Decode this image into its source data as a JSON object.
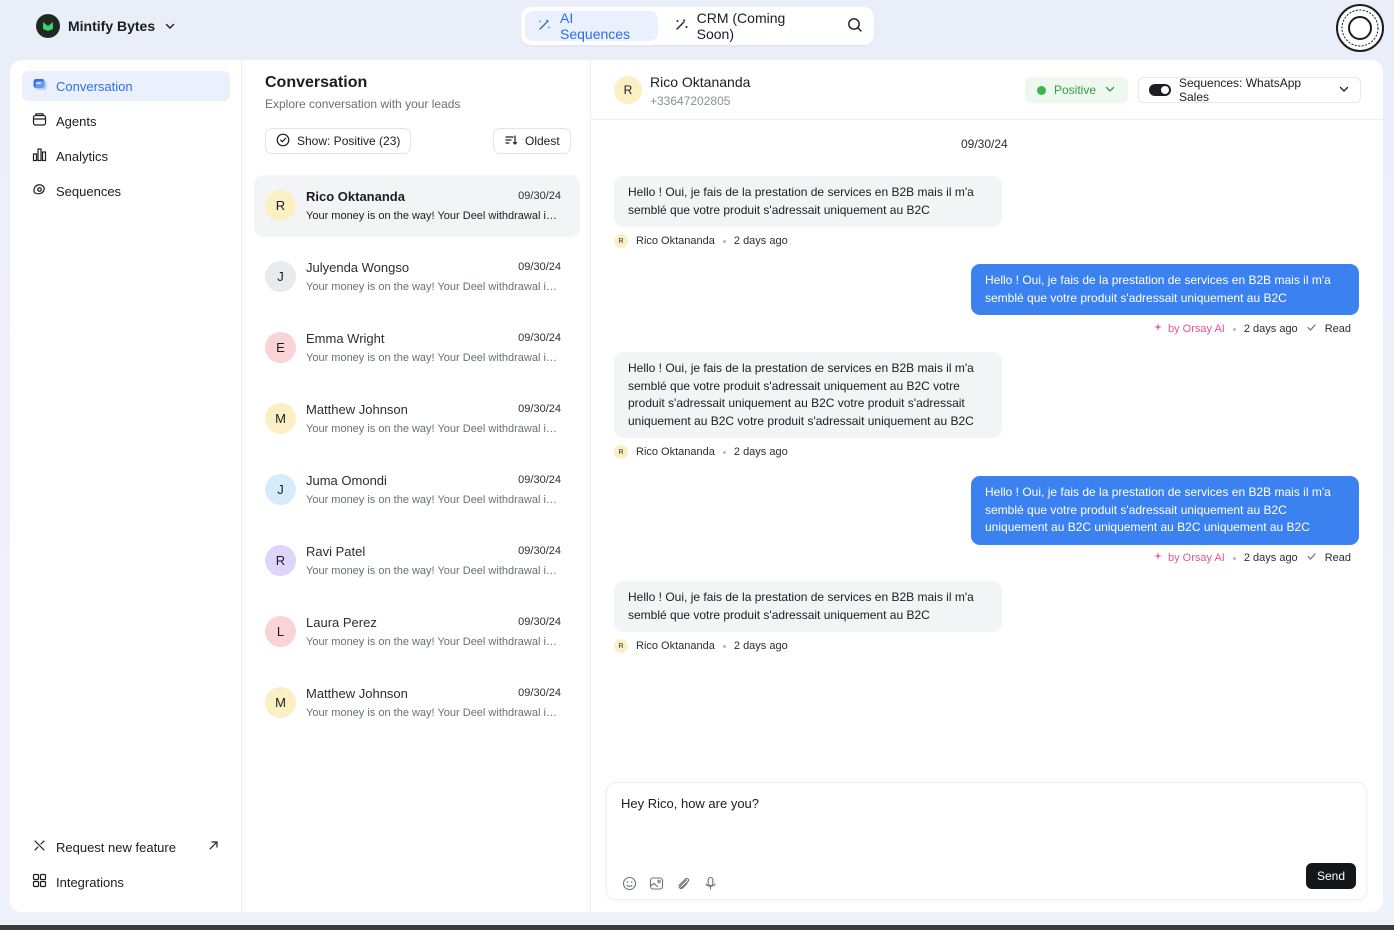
{
  "brand": {
    "name": "Mintify Bytes"
  },
  "topnav": {
    "tabs": [
      {
        "label": "AI Sequences",
        "active": true
      },
      {
        "label": "CRM (Coming Soon)",
        "active": false
      }
    ]
  },
  "sidebar": {
    "items": [
      {
        "label": "Conversation",
        "icon": "chat-icon",
        "active": true
      },
      {
        "label": "Agents",
        "icon": "agent-icon"
      },
      {
        "label": "Analytics",
        "icon": "chart-icon"
      },
      {
        "label": "Sequences",
        "icon": "sequence-icon"
      }
    ],
    "footer": [
      {
        "label": "Request new feature",
        "icon": "wand-icon"
      },
      {
        "label": "Integrations",
        "icon": "grid-icon"
      }
    ]
  },
  "list": {
    "title": "Conversation",
    "subtitle": "Explore conversation with your leads",
    "filter_label": "Show: Positive (23)",
    "sort_label": "Oldest",
    "conversations": [
      {
        "initial": "R",
        "name": "Rico Oktananda",
        "date": "09/30/24",
        "preview": "Your money is on the way! Your Deel withdrawal is on its way",
        "color": "#fbefc4"
      },
      {
        "initial": "J",
        "name": "Julyenda Wongso",
        "date": "09/30/24",
        "preview": "Your money is on the way! Your Deel withdrawal is on its way",
        "color": "#e8eaee"
      },
      {
        "initial": "E",
        "name": "Emma Wright",
        "date": "09/30/24",
        "preview": "Your money is on the way! Your Deel withdrawal is on its way",
        "color": "#f9d3d6"
      },
      {
        "initial": "M",
        "name": "Matthew Johnson",
        "date": "09/30/24",
        "preview": "Your money is on the way! Your Deel withdrawal is on its way",
        "color": "#fbefc4"
      },
      {
        "initial": "J",
        "name": "Juma Omondi",
        "date": "09/30/24",
        "preview": "Your money is on the way! Your Deel withdrawal is on its way",
        "color": "#d6ecfb"
      },
      {
        "initial": "R",
        "name": "Ravi Patel",
        "date": "09/30/24",
        "preview": "Your money is on the way! Your Deel withdrawal is on its way",
        "color": "#ddd6fa"
      },
      {
        "initial": "L",
        "name": "Laura Perez",
        "date": "09/30/24",
        "preview": "Your money is on the way! Your Deel withdrawal is on its way",
        "color": "#f9d3d6"
      },
      {
        "initial": "M",
        "name": "Matthew Johnson",
        "date": "09/30/24",
        "preview": "Your money is on the way! Your Deel withdrawal is on its way",
        "color": "#fbefc4"
      }
    ]
  },
  "chat": {
    "contact_initial": "R",
    "contact_name": "Rico Oktananda",
    "contact_phone": "+33647202805",
    "status": "Positive",
    "sequence": "Sequences: WhatsApp Sales",
    "date_separator": "09/30/24",
    "messages": [
      {
        "dir": "in",
        "text": "Hello ! Oui, je fais de la prestation de services en B2B mais il m'a semblé que votre produit s'adressait uniquement au B2C",
        "sender": "Rico Oktananda",
        "time": "2 days ago"
      },
      {
        "dir": "out",
        "text": "Hello ! Oui, je fais de la prestation de services en B2B mais il m'a semblé que votre produit s'adressait uniquement au B2C",
        "by": "by Orsay AI",
        "time": "2 days ago",
        "status": "Read"
      },
      {
        "dir": "in",
        "text": "Hello ! Oui, je fais de la prestation de services en B2B mais il m'a semblé que votre produit s'adressait uniquement au B2C votre produit s'adressait uniquement au B2C votre produit s'adressait uniquement au B2C votre produit s'adressait uniquement au B2C",
        "sender": "Rico Oktananda",
        "time": "2 days ago"
      },
      {
        "dir": "out",
        "text": "Hello ! Oui, je fais de la prestation de services en B2B mais il m'a semblé que votre produit s'adressait uniquement au B2C uniquement au B2C uniquement au B2C uniquement au B2C",
        "by": "by Orsay AI",
        "time": "2 days ago",
        "status": "Read"
      },
      {
        "dir": "in",
        "text": "Hello ! Oui, je fais de la prestation de services en B2B mais il m'a semblé que votre produit s'adressait uniquement au B2C",
        "sender": "Rico Oktananda",
        "time": "2 days ago"
      }
    ],
    "composer_value": "Hey Rico, how are you?",
    "send_label": "Send"
  },
  "colors": {
    "accent": "#2d6fe6",
    "outgoing_bubble": "#3b82f0",
    "positive": "#2f9e44",
    "ai_label": "#e0559a"
  }
}
